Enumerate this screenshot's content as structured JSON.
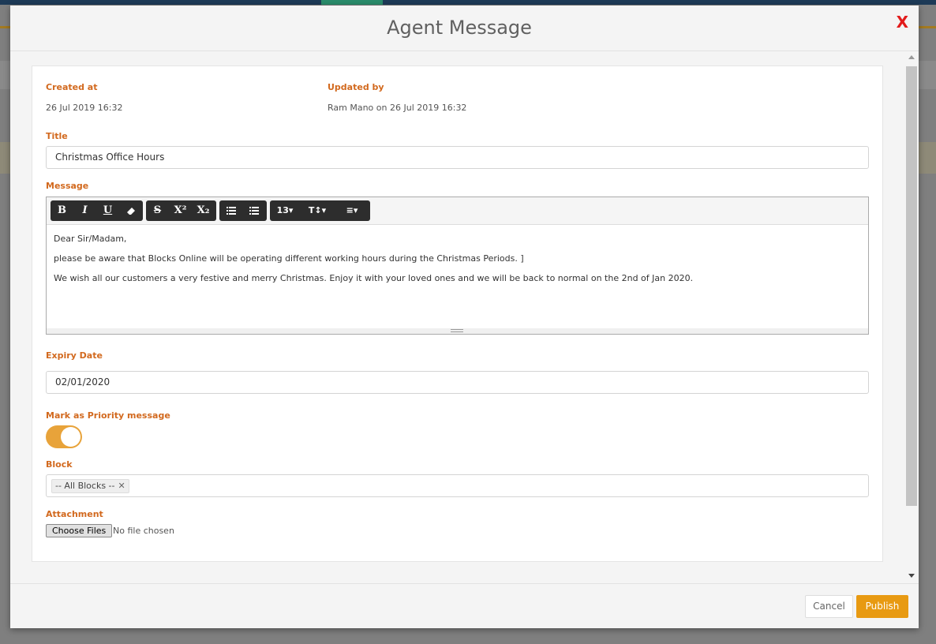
{
  "modal": {
    "title": "Agent Message",
    "close_label": "X"
  },
  "meta": {
    "created_label": "Created at",
    "created_value": "26 Jul 2019 16:32",
    "updated_label": "Updated by",
    "updated_value": "Ram Mano on 26 Jul 2019 16:32"
  },
  "form": {
    "title_label": "Title",
    "title_value": "Christmas Office Hours",
    "message_label": "Message",
    "expiry_label": "Expiry Date",
    "expiry_value": "02/01/2020",
    "priority_label": "Mark as Priority message",
    "priority_on": true,
    "block_label": "Block",
    "block_tag": "-- All Blocks --",
    "attachment_label": "Attachment",
    "choose_files_label": "Choose Files",
    "file_status": "No file chosen"
  },
  "editor": {
    "toolbar": {
      "bold": "B",
      "italic": "I",
      "underline": "U",
      "eraser": "eraser-icon",
      "strike": "S",
      "superscript": "X²",
      "subscript": "X₂",
      "bullet_list": "unordered-list-icon",
      "numbered_list": "ordered-list-icon",
      "font_size": "13▾",
      "line_height": "T↕▾",
      "align": "≡▾"
    },
    "lines": [
      "Dear Sir/Madam,",
      "please be aware that Blocks Online will be operating different working hours during the Christmas Periods. ]",
      "We wish all our customers a very festive and merry Christmas. Enjoy it with your loved ones and we will be back to normal on the 2nd of Jan 2020."
    ]
  },
  "footer": {
    "cancel_label": "Cancel",
    "publish_label": "Publish"
  },
  "colors": {
    "label": "#d2691e",
    "accent": "#e89a12",
    "toggle": "#e8a33a",
    "close": "#e21b1b"
  }
}
